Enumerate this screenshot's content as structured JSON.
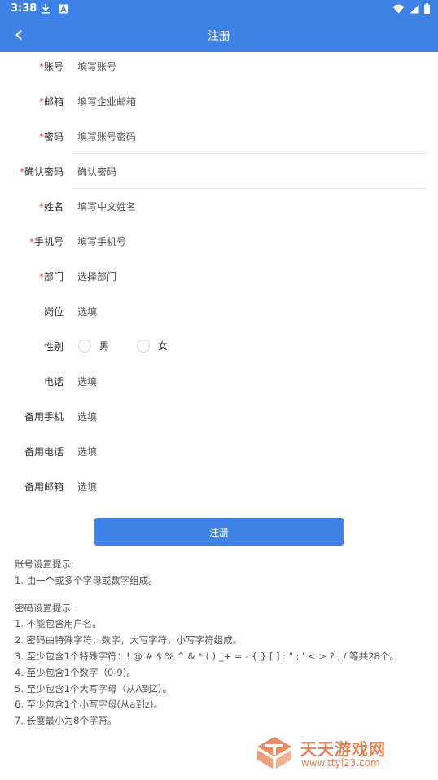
{
  "status_bar": {
    "time": "3:38",
    "icons": [
      "download-icon",
      "a-badge-icon",
      "wifi-icon",
      "signal-icon",
      "battery-icon"
    ]
  },
  "app_bar": {
    "title": "注册",
    "back_icon": "chevron-left-icon"
  },
  "form": {
    "required_mark": "*",
    "account": {
      "label": "账号",
      "placeholder": "填写账号"
    },
    "email": {
      "label": "邮箱",
      "placeholder": "填写企业邮箱"
    },
    "password": {
      "label": "密码",
      "placeholder": "填写账号密码"
    },
    "confirm_password": {
      "label": "确认密码",
      "placeholder": "确认密码"
    },
    "name": {
      "label": "姓名",
      "placeholder": "填写中文姓名"
    },
    "mobile": {
      "label": "手机号",
      "placeholder": "填写手机号"
    },
    "department": {
      "label": "部门",
      "placeholder": "选择部门"
    },
    "position": {
      "label": "岗位",
      "placeholder": "选填"
    },
    "gender": {
      "label": "性别",
      "options": [
        "男",
        "女"
      ]
    },
    "phone": {
      "label": "电话",
      "placeholder": "选填"
    },
    "backup_mobile": {
      "label": "备用手机",
      "placeholder": "选填"
    },
    "backup_phone": {
      "label": "备用电话",
      "placeholder": "选填"
    },
    "backup_email": {
      "label": "备用邮箱",
      "placeholder": "选填"
    },
    "submit_label": "注册"
  },
  "tips": {
    "account_title": "账号设置提示:",
    "account_lines": [
      "1. 由一个或多个字母或数字组成。"
    ],
    "password_title": "密码设置提示:",
    "password_lines": [
      "1. 不能包含用户名。",
      "2. 密码由特殊字符，数字，大写字符，小写字符组成。",
      "3. 至少包含1个特殊字符：! @ # $ % ^ & * ( ) _+ = - { } [ ] : \" ; ' < > ? , / 等共28个。",
      "4. 至少包含1个数字（0-9)。",
      "5. 至少包含1个大写字母（从A到Z）。",
      "6. 至少包含1个小写字母(从a到z)。",
      "7. 长度最小为8个字符。"
    ]
  },
  "watermark": {
    "name": "天天游戏网",
    "url": "www.ttyl23.com",
    "accent": "#e2733c"
  },
  "colors": {
    "primary": "#3e82e8",
    "required": "#e53935"
  }
}
